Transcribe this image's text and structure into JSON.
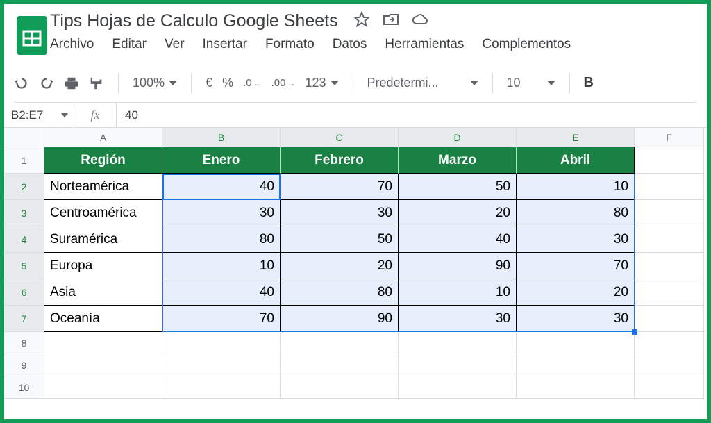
{
  "doc_title": "Tips Hojas de Calculo Google Sheets",
  "menu": [
    "Archivo",
    "Editar",
    "Ver",
    "Insertar",
    "Formato",
    "Datos",
    "Herramientas",
    "Complementos"
  ],
  "toolbar": {
    "zoom": "100%",
    "currency": "€",
    "percent": "%",
    "dec_minus": ".0",
    "dec_plus": ".00",
    "numfmt": "123",
    "font": "Predetermi...",
    "font_size": "10",
    "bold": "B"
  },
  "name_box": "B2:E7",
  "fx_label": "fx",
  "fx_value": "40",
  "columns": [
    "A",
    "B",
    "C",
    "D",
    "E",
    "F"
  ],
  "row_numbers": [
    "1",
    "2",
    "3",
    "4",
    "5",
    "6",
    "7",
    "8",
    "9",
    "10"
  ],
  "table": {
    "headers": [
      "Región",
      "Enero",
      "Febrero",
      "Marzo",
      "Abril"
    ],
    "rows": [
      {
        "region": "Norteamérica",
        "vals": [
          "40",
          "70",
          "50",
          "10"
        ]
      },
      {
        "region": "Centroamérica",
        "vals": [
          "30",
          "30",
          "20",
          "80"
        ]
      },
      {
        "region": "Suramérica",
        "vals": [
          "80",
          "50",
          "40",
          "30"
        ]
      },
      {
        "region": "Europa",
        "vals": [
          "10",
          "20",
          "90",
          "70"
        ]
      },
      {
        "region": "Asia",
        "vals": [
          "40",
          "80",
          "10",
          "20"
        ]
      },
      {
        "region": "Oceanía",
        "vals": [
          "70",
          "90",
          "30",
          "30"
        ]
      }
    ]
  }
}
